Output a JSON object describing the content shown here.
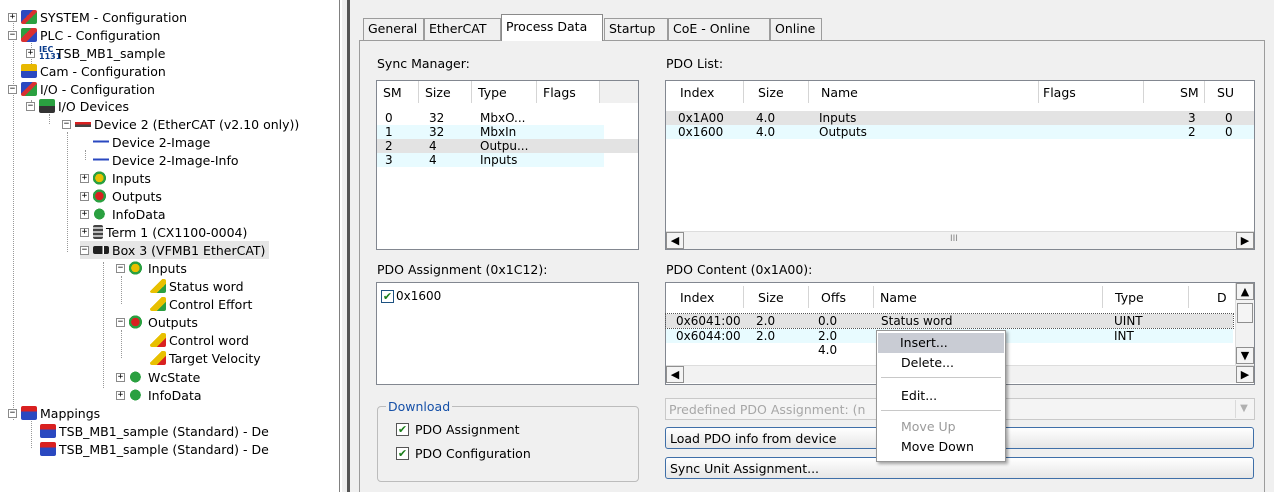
{
  "tree": {
    "items": [
      {
        "id": "system",
        "label": "SYSTEM - Configuration",
        "icon": "system-config-icon"
      },
      {
        "id": "plc",
        "label": "PLC - Configuration",
        "icon": "plc-config-icon"
      },
      {
        "id": "tsb",
        "label": "TSB_MB1_sample",
        "icon": "iec-project-icon"
      },
      {
        "id": "cam",
        "label": "Cam - Configuration",
        "icon": "cam-config-icon"
      },
      {
        "id": "io",
        "label": "I/O - Configuration",
        "icon": "io-config-icon"
      },
      {
        "id": "iodev",
        "label": "I/O Devices",
        "icon": "io-devices-icon"
      },
      {
        "id": "dev2",
        "label": "Device 2 (EtherCAT (v2.10 only))",
        "icon": "ethercat-device-icon"
      },
      {
        "id": "dev2img",
        "label": "Device 2-Image",
        "icon": "image-icon"
      },
      {
        "id": "dev2imginfo",
        "label": "Device 2-Image-Info",
        "icon": "image-info-icon"
      },
      {
        "id": "inputs1",
        "label": "Inputs",
        "icon": "inputs-icon"
      },
      {
        "id": "outputs1",
        "label": "Outputs",
        "icon": "outputs-icon"
      },
      {
        "id": "infodata1",
        "label": "InfoData",
        "icon": "infodata-icon"
      },
      {
        "id": "term1",
        "label": "Term 1 (CX1100-0004)",
        "icon": "terminal-icon"
      },
      {
        "id": "box3",
        "label": "Box 3 (VFMB1 EtherCAT)",
        "icon": "box-icon"
      },
      {
        "id": "inputs2",
        "label": "Inputs",
        "icon": "inputs-icon"
      },
      {
        "id": "statusword",
        "label": "Status word",
        "icon": "input-variable-icon"
      },
      {
        "id": "controleffort",
        "label": "Control Effort",
        "icon": "input-variable-icon"
      },
      {
        "id": "outputs2",
        "label": "Outputs",
        "icon": "outputs-icon"
      },
      {
        "id": "controlword",
        "label": "Control word",
        "icon": "output-variable-icon"
      },
      {
        "id": "targetvel",
        "label": "Target Velocity",
        "icon": "output-variable-icon"
      },
      {
        "id": "wcstate",
        "label": "WcState",
        "icon": "wcstate-icon"
      },
      {
        "id": "infodata2",
        "label": "InfoData",
        "icon": "infodata-icon"
      },
      {
        "id": "mappings",
        "label": "Mappings",
        "icon": "mappings-icon"
      },
      {
        "id": "map1",
        "label": "TSB_MB1_sample (Standard) - De",
        "icon": "mapping-icon"
      },
      {
        "id": "map2",
        "label": "TSB_MB1_sample (Standard) - De",
        "icon": "mapping-icon"
      }
    ]
  },
  "tabs": [
    "General",
    "EtherCAT",
    "Process Data",
    "Startup",
    "CoE - Online",
    "Online"
  ],
  "sync_manager": {
    "label": "Sync Manager:",
    "columns": [
      "SM",
      "Size",
      "Type",
      "Flags"
    ],
    "rows": [
      [
        "0",
        "32",
        "MbxO...",
        ""
      ],
      [
        "1",
        "32",
        "MbxIn",
        ""
      ],
      [
        "2",
        "4",
        "Outpu...",
        ""
      ],
      [
        "3",
        "4",
        "Inputs",
        ""
      ]
    ]
  },
  "pdo_list": {
    "label": "PDO List:",
    "columns": [
      "Index",
      "Size",
      "Name",
      "Flags",
      "SM",
      "SU"
    ],
    "rows": [
      [
        "0x1A00",
        "4.0",
        "Inputs",
        "",
        "3",
        "0"
      ],
      [
        "0x1600",
        "4.0",
        "Outputs",
        "",
        "2",
        "0"
      ]
    ]
  },
  "pdo_assignment": {
    "label": "PDO Assignment (0x1C12):",
    "items": [
      {
        "label": "0x1600",
        "checked": true
      }
    ]
  },
  "pdo_content": {
    "label": "PDO Content (0x1A00):",
    "columns": [
      "Index",
      "Size",
      "Offs",
      "Name",
      "Type",
      "D"
    ],
    "rows": [
      [
        "0x6041:00",
        "2.0",
        "0.0",
        "Status word",
        "UINT",
        ""
      ],
      [
        "0x6044:00",
        "2.0",
        "2.0",
        "",
        "INT",
        ""
      ],
      [
        "",
        "",
        "4.0",
        "",
        "",
        ""
      ]
    ]
  },
  "download": {
    "title": "Download",
    "pdo_assignment": "PDO Assignment",
    "pdo_configuration": "PDO Configuration"
  },
  "predefined": {
    "value": "Predefined PDO Assignment: (n"
  },
  "buttons": {
    "load_pdo": "Load PDO info from device",
    "sync_unit": "Sync Unit Assignment..."
  },
  "context_menu": {
    "insert": "Insert...",
    "delete": "Delete...",
    "edit": "Edit...",
    "move_up": "Move Up",
    "move_down": "Move Down"
  },
  "scroll": {
    "grip": "III"
  }
}
